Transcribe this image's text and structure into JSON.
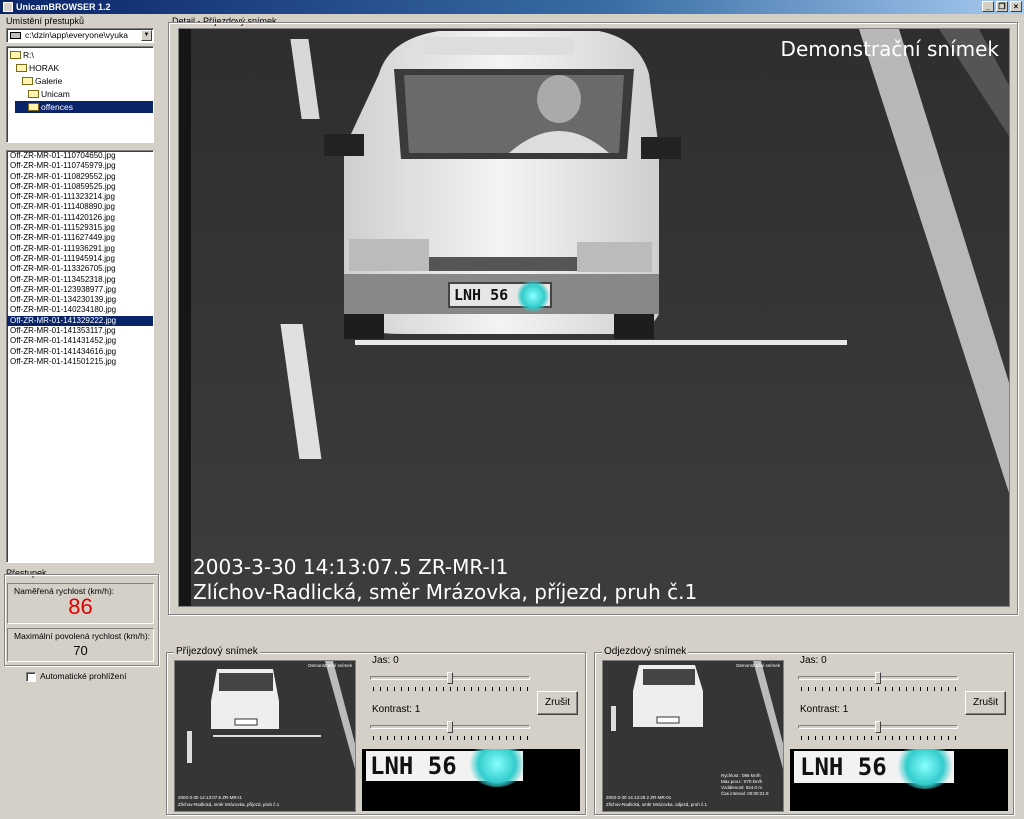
{
  "window": {
    "title": "UnicamBROWSER 1.2"
  },
  "left": {
    "location_label": "Umístění přestupků",
    "path": "c:\\dzin\\app\\everyone\\vyuka",
    "tree": [
      "R:\\",
      "HORAK",
      "Galerie",
      "Unicam",
      "offences"
    ],
    "files": [
      "Off-ZR-MR-01-110704650.jpg",
      "Off-ZR-MR-01-110745979.jpg",
      "Off-ZR-MR-01-110829552.jpg",
      "Off-ZR-MR-01-110859525.jpg",
      "Off-ZR-MR-01-111323214.jpg",
      "Off-ZR-MR-01-111408890.jpg",
      "Off-ZR-MR-01-111420126.jpg",
      "Off-ZR-MR-01-111529315.jpg",
      "Off-ZR-MR-01-111627449.jpg",
      "Off-ZR-MR-01-111936291.jpg",
      "Off-ZR-MR-01-111945914.jpg",
      "Off-ZR-MR-01-113326705.jpg",
      "Off-ZR-MR-01-113452318.jpg",
      "Off-ZR-MR-01-123938977.jpg",
      "Off-ZR-MR-01-134230139.jpg",
      "Off-ZR-MR-01-140234180.jpg",
      "Off-ZR-MR-01-141329222.jpg",
      "Off-ZR-MR-01-141353117.jpg",
      "Off-ZR-MR-01-141431452.jpg",
      "Off-ZR-MR-01-141434616.jpg",
      "Off-ZR-MR-01-141501215.jpg"
    ],
    "selected_file_index": 16,
    "offence_label": "Přestupek",
    "measured_label": "Naměřená rychlost (km/h):",
    "measured_value": "86",
    "max_label": "Maximální povolená rychlost (km/h):",
    "max_value": "70",
    "auto_browse_label": "Automatické prohlížení",
    "colors": {
      "measured": "#e00000",
      "selection": "#0a246a"
    }
  },
  "detail": {
    "label": "Detail - Příjezdový snímek",
    "watermark": "Demonstrační snímek",
    "line1": "2003-3-30 14:13:07.5 ZR-MR-I1",
    "line2": "Zlíchov-Radlická, směr Mrázovka, příjezd, pruh č.1",
    "plate": "LNH 56"
  },
  "arrival": {
    "label": "Příjezdový snímek",
    "brightness_label": "Jas: 0",
    "brightness": 0,
    "contrast_label": "Kontrast: 1",
    "contrast": 1,
    "cancel": "Zrušit",
    "plate": "LNH 56",
    "thumb_watermark": "Demonstrační snímek",
    "thumb_line1": "2003-3-30 14:13:07.5 ZR-MR-I1",
    "thumb_line2": "Zlíchov-Radlická, směr Mrázovka, příjezd, pruh č.1"
  },
  "departure": {
    "label": "Odjezdový snímek",
    "brightness_label": "Jas: 0",
    "brightness": 0,
    "contrast_label": "Kontrast: 1",
    "contrast": 1,
    "cancel": "Zrušit",
    "plate": "LNH 56",
    "thumb_watermark": "Demonstrační snímek",
    "thumb_line1": "2003-3-30 14:13:29.2 ZR-MR-01",
    "thumb_line2": "Zlíchov-Radlická, směr Mrázovka, odjezd, pruh č.1",
    "stats": [
      "Rychlost : 086 km/h",
      "Max.pov.r.: 070 km/h",
      "Vzdálenost: 524.0 m",
      "Čas interval: 00:00:21.9"
    ]
  }
}
